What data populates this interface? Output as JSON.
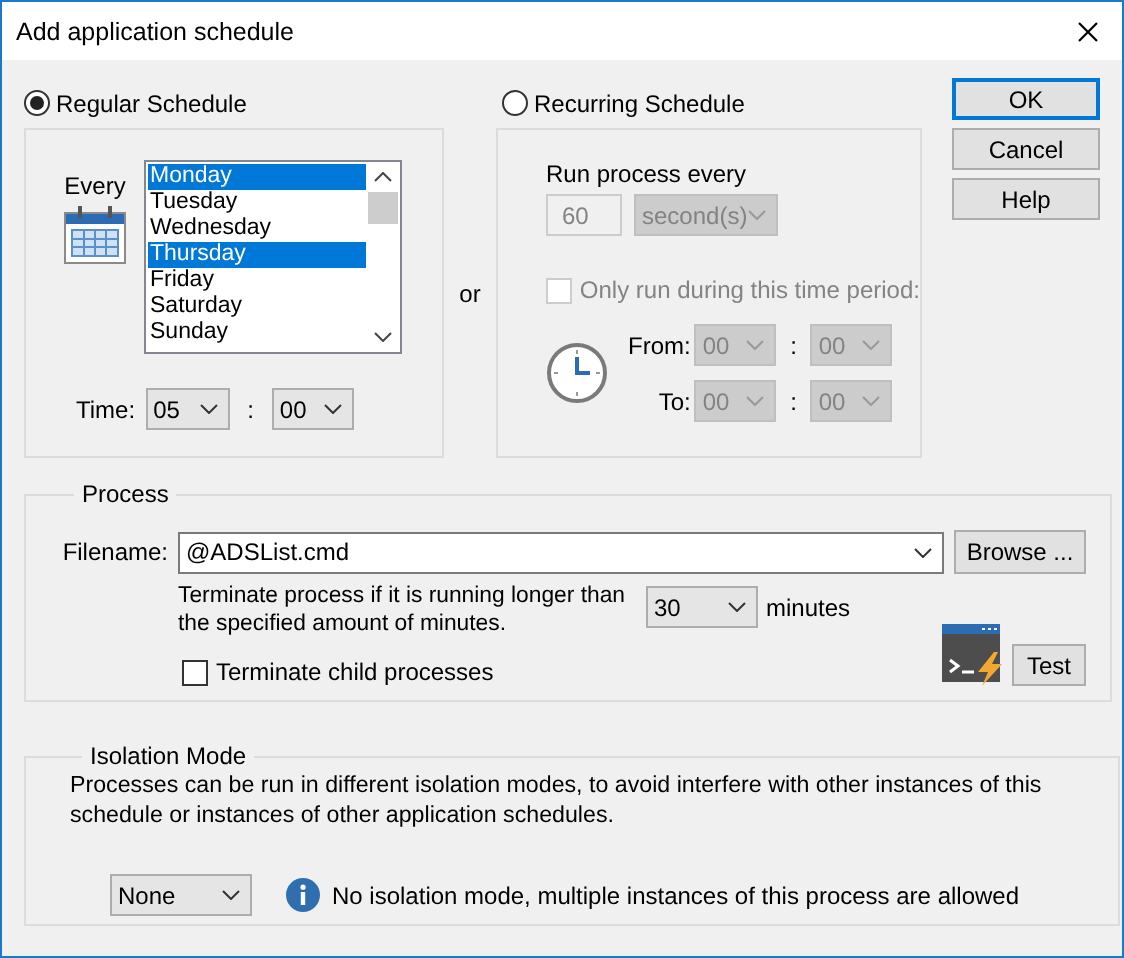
{
  "window": {
    "title": "Add application schedule"
  },
  "schedule_type": [
    {
      "label": "Regular Schedule",
      "selected": true
    },
    {
      "label": "Recurring Schedule",
      "selected": false
    }
  ],
  "regular": {
    "every_label": "Every",
    "days": [
      {
        "label": "Monday",
        "selected": true
      },
      {
        "label": "Tuesday",
        "selected": false
      },
      {
        "label": "Wednesday",
        "selected": false
      },
      {
        "label": "Thursday",
        "selected": true
      },
      {
        "label": "Friday",
        "selected": false
      },
      {
        "label": "Saturday",
        "selected": false
      },
      {
        "label": "Sunday",
        "selected": false
      }
    ],
    "time_label": "Time:",
    "hour": "05",
    "time_separator": ":",
    "minute": "00"
  },
  "or_label": "or",
  "recurring": {
    "disabled": true,
    "run_every_label": "Run process every",
    "interval": "60",
    "unit": "second(s)",
    "time_period": {
      "label": "Only run during this time period:",
      "checked": false
    },
    "from_label": "From:",
    "from_hour": "00",
    "from_separator": ":",
    "from_minute": "00",
    "to_label": "To:",
    "to_hour": "00",
    "to_separator": ":",
    "to_minute": "00"
  },
  "buttons": [
    {
      "label": "OK",
      "default": true
    },
    {
      "label": "Cancel",
      "default": false
    },
    {
      "label": "Help",
      "default": false
    }
  ],
  "process": {
    "title": "Process",
    "filename_label": "Filename:",
    "filename": "@ADSList.cmd",
    "browse": "Browse ...",
    "terminate_text": "Terminate process if it is running longer than the specified amount of minutes.",
    "timeout": "30",
    "timeout_unit": "minutes",
    "terminate_children": {
      "label": "Terminate child processes",
      "checked": false
    },
    "test": "Test"
  },
  "isolation": {
    "title": "Isolation Mode",
    "description": "Processes can be run in different isolation modes, to avoid interfere with other instances of this schedule or instances of other application schedules.",
    "mode": "None",
    "info": "No isolation mode, multiple instances of this process are allowed"
  }
}
